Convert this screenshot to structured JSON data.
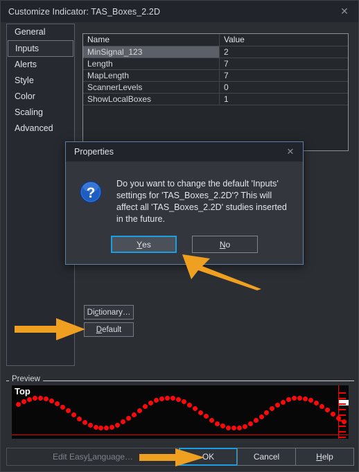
{
  "window": {
    "title": "Customize Indicator: TAS_Boxes_2.2D",
    "close_icon": "close-icon"
  },
  "tabs": [
    {
      "label": "General",
      "selected": false
    },
    {
      "label": "Inputs",
      "selected": true
    },
    {
      "label": "Alerts",
      "selected": false
    },
    {
      "label": "Style",
      "selected": false
    },
    {
      "label": "Color",
      "selected": false
    },
    {
      "label": "Scaling",
      "selected": false
    },
    {
      "label": "Advanced",
      "selected": false
    }
  ],
  "grid": {
    "columns": [
      "Name",
      "Value"
    ],
    "rows": [
      {
        "name": "MinSignal_123",
        "value": "2",
        "selected": true
      },
      {
        "name": "Length",
        "value": "7",
        "selected": false
      },
      {
        "name": "MapLength",
        "value": "7",
        "selected": false
      },
      {
        "name": "ScannerLevels",
        "value": "0",
        "selected": false
      },
      {
        "name": "ShowLocalBoxes",
        "value": "1",
        "selected": false
      }
    ]
  },
  "side_buttons": {
    "dictionary": {
      "pre": "Di",
      "accel": "c",
      "post": "tionary…"
    },
    "default": {
      "pre": "",
      "accel": "D",
      "post": "efault"
    }
  },
  "modal": {
    "title": "Properties",
    "close_icon": "close-icon",
    "icon": "question-mark-icon",
    "message": "Do you want to change the default 'Inputs' settings for 'TAS_Boxes_2.2D'? This will affect all 'TAS_Boxes_2.2D' studies inserted in the future.",
    "yes": {
      "pre": "",
      "accel": "Y",
      "post": "es"
    },
    "no": {
      "pre": "",
      "accel": "N",
      "post": "o"
    }
  },
  "preview": {
    "legend": "Preview",
    "top_label": "Top",
    "series_color": "#fa0a0a",
    "background": "#070707"
  },
  "bottom_bar": {
    "edit_easylanguage": {
      "pre": "Edit Easy",
      "accel": "L",
      "post": "anguage…"
    },
    "ok": "OK",
    "cancel": "Cancel",
    "help": {
      "pre": "",
      "accel": "H",
      "post": "elp"
    }
  },
  "annotations": {
    "arrow_color": "#f0a021",
    "arrow_default_target": "Default",
    "arrow_yes_target": "Yes",
    "arrow_ok_target": "OK"
  },
  "chart_data": {
    "type": "line",
    "title": "Top",
    "series": [
      {
        "name": "TAS_Boxes_2.2D",
        "style": "dotted",
        "color": "#fa0a0a",
        "points": 60,
        "shape": "sine",
        "cycles": 2.5
      }
    ],
    "xlabel": "",
    "ylabel": "",
    "grid": false,
    "legend": "none"
  }
}
